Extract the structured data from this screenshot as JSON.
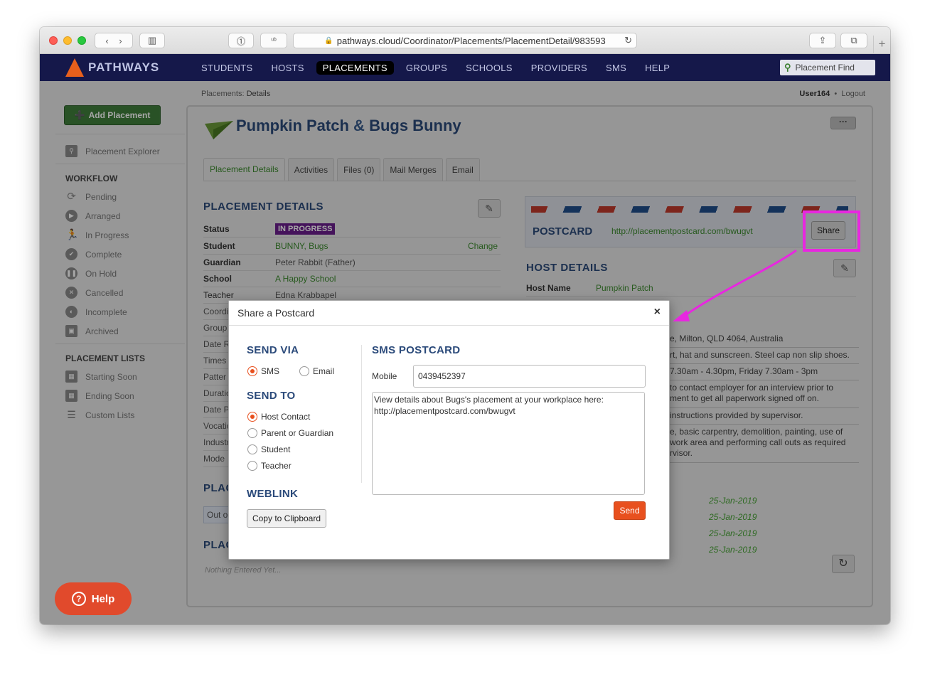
{
  "browser": {
    "url": "pathways.cloud/Coordinator/Placements/PlacementDetail/983593",
    "reader_btn": "⓵",
    "ub_btn": "ᵘᵇ"
  },
  "nav": {
    "brand": "PATHWAYS",
    "items": [
      "STUDENTS",
      "HOSTS",
      "PLACEMENTS",
      "GROUPS",
      "SCHOOLS",
      "PROVIDERS",
      "SMS",
      "HELP"
    ],
    "active": "PLACEMENTS",
    "search_placeholder": "Placement Find"
  },
  "breadcrumb": {
    "parent": "Placements:",
    "current": "Details"
  },
  "user": {
    "name": "User164",
    "sep": "•",
    "logout": "Logout"
  },
  "sidebar": {
    "add_button": "Add Placement",
    "explorer": "Placement Explorer",
    "workflow_head": "WORKFLOW",
    "workflow": [
      "Pending",
      "Arranged",
      "In Progress",
      "Complete",
      "On Hold",
      "Cancelled",
      "Incomplete",
      "Archived"
    ],
    "lists_head": "PLACEMENT LISTS",
    "lists": [
      "Starting Soon",
      "Ending Soon",
      "Custom Lists"
    ]
  },
  "page": {
    "title_a": "Pumpkin Patch",
    "title_amp": "&",
    "title_b": "Bugs Bunny",
    "more": "···",
    "tabs": [
      "Placement Details",
      "Activities",
      "Files (0)",
      "Mail Merges",
      "Email"
    ]
  },
  "details": {
    "heading": "PLACEMENT DETAILS",
    "rows": [
      {
        "k": "Status",
        "v": "IN PROGRESS"
      },
      {
        "k": "Student",
        "v": "BUNNY, Bugs",
        "action": "Change"
      },
      {
        "k": "Guardian",
        "v": "Peter Rabbit (Father)"
      },
      {
        "k": "School",
        "v": "A Happy School"
      },
      {
        "k": "Teacher",
        "v": "Edna Krabbapel"
      }
    ],
    "partial_rows": [
      "Coordi",
      "Group",
      "Date R",
      "Times",
      "Patter",
      "Duratio",
      "Date P",
      "Vocatio",
      "Industr",
      "Mode"
    ],
    "sec2_partial": "PLAC",
    "sec3_partial": "PLAC",
    "out_partial": "Out o",
    "nothing": "Nothing Entered Yet..."
  },
  "postcard": {
    "heading": "POSTCARD",
    "url": "http://placementpostcard.com/bwugvt",
    "share": "Share"
  },
  "host": {
    "heading": "HOST DETAILS",
    "name_label": "Host Name",
    "name_value": "Pumpkin Patch",
    "partial_rows": [
      "e, Milton, QLD 4064, Australia",
      "rt, hat and sunscreen. Steel cap non slip shoes.",
      "7.30am - 4.30pm, Friday 7.30am - 3pm",
      "to contact employer for an interview prior to\nment to get all paperwork signed off on.",
      "instructions provided by supervisor.",
      "e, basic carpentry, demolition, painting, use of\nwork area and performing call outs as required\nrvisor."
    ],
    "dates": [
      "25-Jan-2019",
      "25-Jan-2019",
      "25-Jan-2019",
      "25-Jan-2019"
    ]
  },
  "help": {
    "label": "Help"
  },
  "modal": {
    "title": "Share a Postcard",
    "close": "×",
    "send_via": "SEND VIA",
    "via_options": [
      "SMS",
      "Email"
    ],
    "send_to": "SEND TO",
    "to_options": [
      "Host Contact",
      "Parent or Guardian",
      "Student",
      "Teacher"
    ],
    "weblink": "WEBLINK",
    "copy_button": "Copy to Clipboard",
    "sms_heading": "SMS POSTCARD",
    "mobile_label": "Mobile",
    "mobile_value": "0439452397",
    "message": "View details about Bugs's placement at your workplace here:\nhttp://placementpostcard.com/bwugvt",
    "send_button": "Send"
  },
  "colors": {
    "nav_bg": "#15184a",
    "accent_green": "#3d8b2f",
    "heading_blue": "#2b4a7a",
    "send_orange": "#e8501e",
    "highlight_magenta": "#e827e0",
    "status_purple": "#6a1e8c"
  }
}
